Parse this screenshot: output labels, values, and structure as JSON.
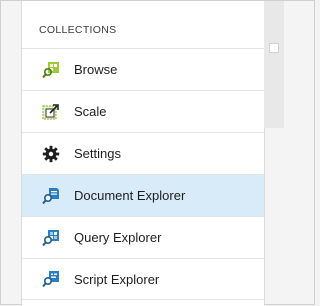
{
  "section": {
    "title": "COLLECTIONS"
  },
  "menu": {
    "items": [
      {
        "label": "Browse",
        "icon": "browse-icon",
        "selected": false
      },
      {
        "label": "Scale",
        "icon": "scale-icon",
        "selected": false
      },
      {
        "label": "Settings",
        "icon": "gear-icon",
        "selected": false
      },
      {
        "label": "Document Explorer",
        "icon": "document-explorer-icon",
        "selected": true
      },
      {
        "label": "Query Explorer",
        "icon": "query-explorer-icon",
        "selected": false
      },
      {
        "label": "Script Explorer",
        "icon": "script-explorer-icon",
        "selected": false
      }
    ]
  },
  "colors": {
    "selected_background": "#d8ebf8",
    "icon_green": "#7ab51d",
    "icon_blue": "#2a7fc1"
  }
}
